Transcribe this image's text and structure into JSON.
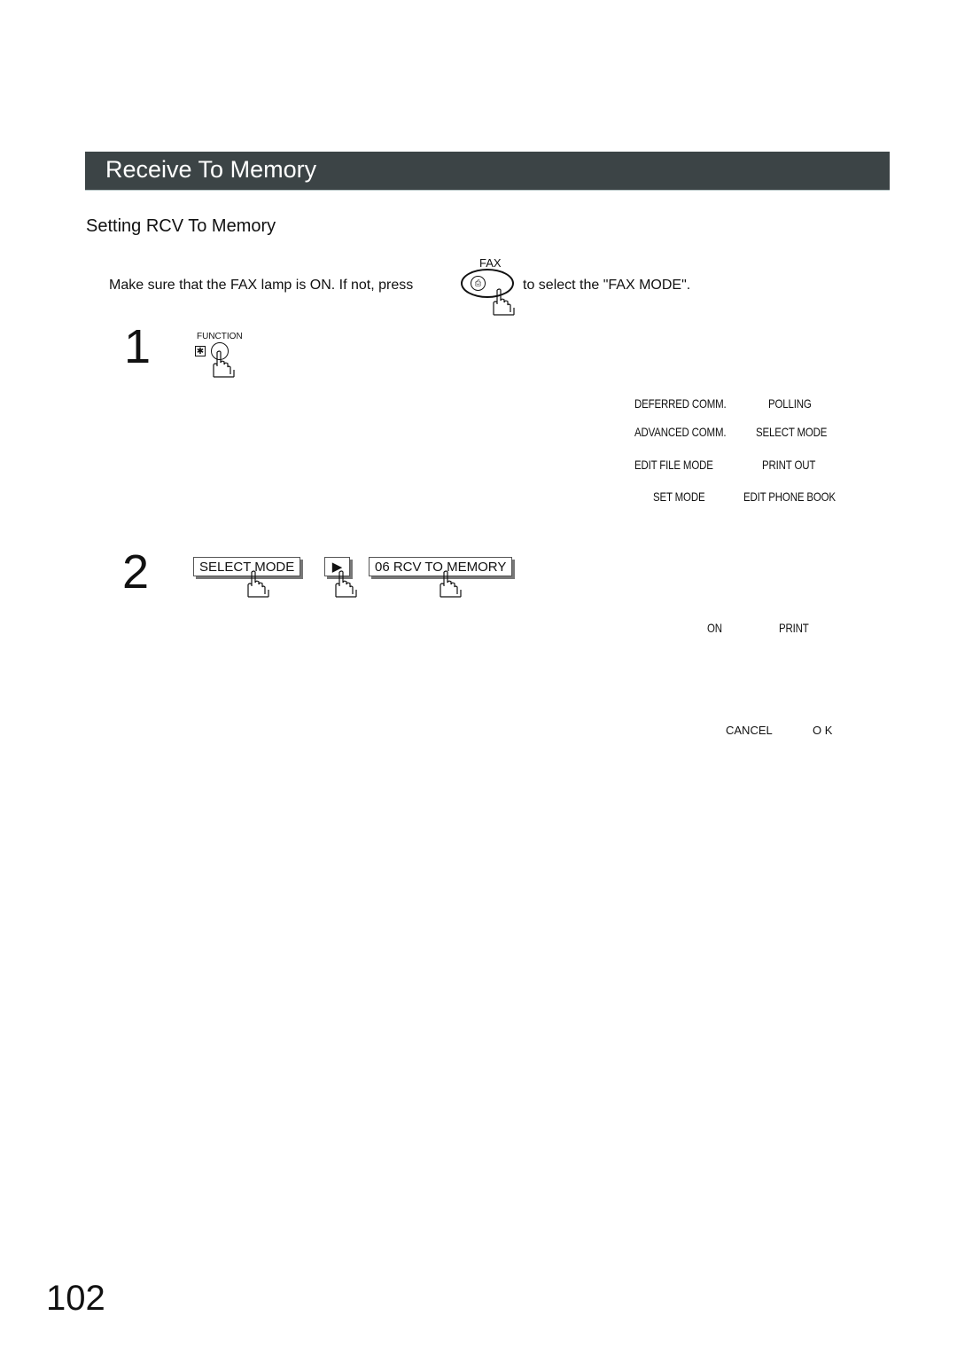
{
  "header": {
    "title": "Receive To Memory",
    "bar_color": "#3c4446"
  },
  "section": {
    "title": "Setting RCV To Memory"
  },
  "instruction": {
    "text_before": "Make sure that the FAX lamp is ON.  If not, press",
    "key_label": "FAX",
    "key_icon": "fax-mode-key-icon",
    "text_after": "to select the \"FAX MODE\"."
  },
  "steps": [
    {
      "number": "1",
      "key_label": "FUNCTION",
      "key_symbol": "✱",
      "display_options": [
        [
          "DEFERRED COMM.",
          "POLLING"
        ],
        [
          "ADVANCED COMM.",
          "SELECT MODE"
        ],
        [
          "EDIT FILE MODE",
          "PRINT OUT"
        ],
        [
          "SET MODE",
          "EDIT PHONE BOOK"
        ]
      ]
    },
    {
      "number": "2",
      "softkeys": [
        "SELECT MODE",
        "▶",
        "06 RCV TO MEMORY"
      ],
      "display_options": [
        "ON",
        "PRINT"
      ],
      "actions": [
        "CANCEL",
        "O K"
      ]
    }
  ],
  "page_number": "102"
}
